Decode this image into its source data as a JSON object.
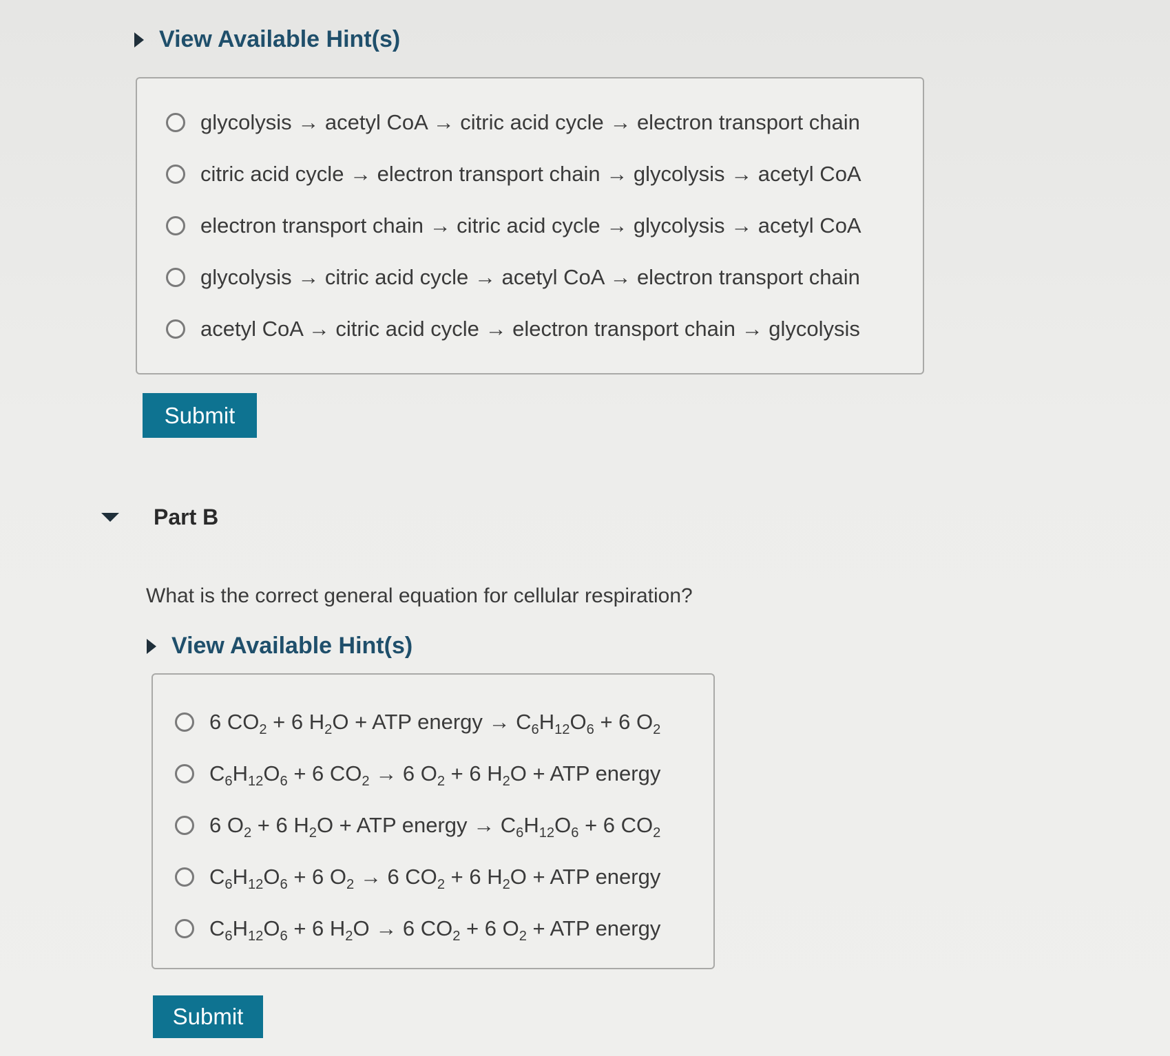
{
  "part_a": {
    "hint_label": "View Available Hint(s)",
    "choices": [
      "glycolysis → acetyl CoA → citric acid cycle → electron transport chain",
      "citric acid cycle → electron transport chain → glycolysis → acetyl CoA",
      "electron transport chain → citric acid cycle → glycolysis → acetyl CoA",
      "glycolysis → citric acid cycle → acetyl CoA → electron transport chain",
      "acetyl CoA → citric acid cycle → electron transport chain → glycolysis"
    ],
    "submit_label": "Submit"
  },
  "part_b": {
    "title": "Part B",
    "question": "What is the correct general equation for cellular respiration?",
    "hint_label": "View Available Hint(s)",
    "choices": [
      "6 CO2 + 6 H2O + ATP energy → C6H12O6 + 6 O2",
      "C6H12O6 + 6 CO2 → 6 O2 + 6 H2O + ATP energy",
      "6 O2 + 6 H2O + ATP energy → C6H12O6 + 6 CO2",
      "C6H12O6 + 6 O2 → 6 CO2 + 6 H2O + ATP energy",
      "C6H12O6 + 6 H2O → 6 CO2 + 6 O2 + ATP energy"
    ],
    "submit_label": "Submit"
  },
  "colors": {
    "submit_bg": "#0e7391",
    "hint_text": "#1f4f6b"
  }
}
